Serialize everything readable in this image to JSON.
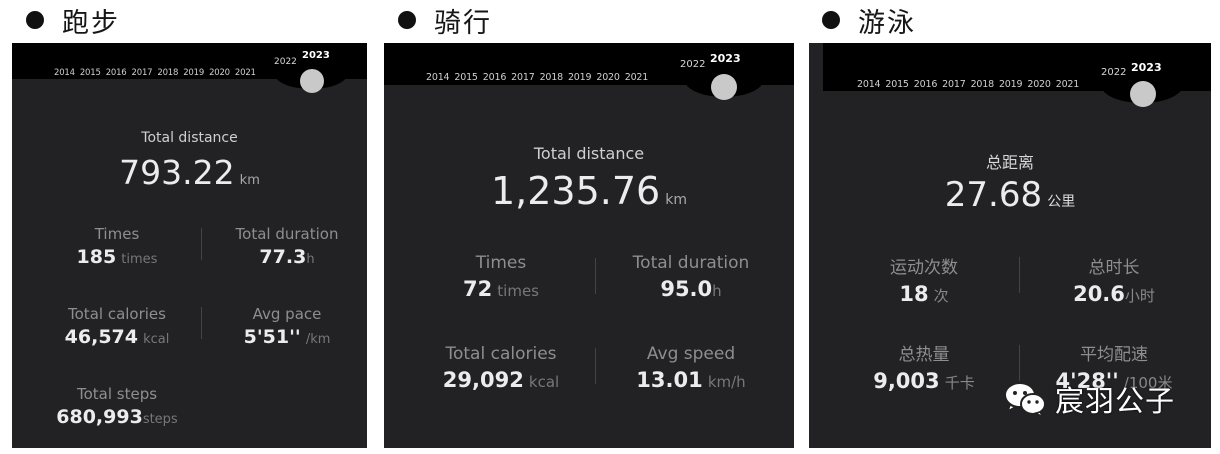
{
  "sections": {
    "run": {
      "title": "跑步",
      "years": [
        "2014",
        "2015",
        "2016",
        "2017",
        "2018",
        "2019",
        "2020",
        "2021"
      ],
      "year_2022": "2022",
      "year_2023": "2023",
      "total_label": "Total distance",
      "total_value": "793.22",
      "total_unit": "km",
      "stats": {
        "times_label": "Times",
        "times_value": "185",
        "times_unit": "times",
        "duration_label": "Total duration",
        "duration_value": "77.3",
        "duration_unit": "h",
        "calories_label": "Total calories",
        "calories_value": "46,574",
        "calories_unit": "kcal",
        "pace_label": "Avg pace",
        "pace_value": "5'51''",
        "pace_unit": "/km",
        "steps_label": "Total steps",
        "steps_value": "680,993",
        "steps_unit": "steps"
      }
    },
    "ride": {
      "title": "骑行",
      "years": [
        "2014",
        "2015",
        "2016",
        "2017",
        "2018",
        "2019",
        "2020",
        "2021"
      ],
      "year_2022": "2022",
      "year_2023": "2023",
      "total_label": "Total distance",
      "total_value": "1,235.76",
      "total_unit": "km",
      "stats": {
        "times_label": "Times",
        "times_value": "72",
        "times_unit": "times",
        "duration_label": "Total duration",
        "duration_value": "95.0",
        "duration_unit": "h",
        "calories_label": "Total calories",
        "calories_value": "29,092",
        "calories_unit": "kcal",
        "speed_label": "Avg speed",
        "speed_value": "13.01",
        "speed_unit": "km/h"
      }
    },
    "swim": {
      "title": "游泳",
      "years": [
        "2014",
        "2015",
        "2016",
        "2017",
        "2018",
        "2019",
        "2020",
        "2021"
      ],
      "year_2022": "2022",
      "year_2023": "2023",
      "total_label": "总距离",
      "total_value": "27.68",
      "total_unit": "公里",
      "stats": {
        "times_label": "运动次数",
        "times_value": "18",
        "times_unit": "次",
        "duration_label": "总时长",
        "duration_value": "20.6",
        "duration_unit": "小时",
        "calories_label": "总热量",
        "calories_value": "9,003",
        "calories_unit": "千卡",
        "pace_label": "平均配速",
        "pace_value": "4'28''",
        "pace_unit": "/100米"
      }
    }
  },
  "watermark": {
    "text": "宸羽公子",
    "icon": "wechat-icon"
  }
}
